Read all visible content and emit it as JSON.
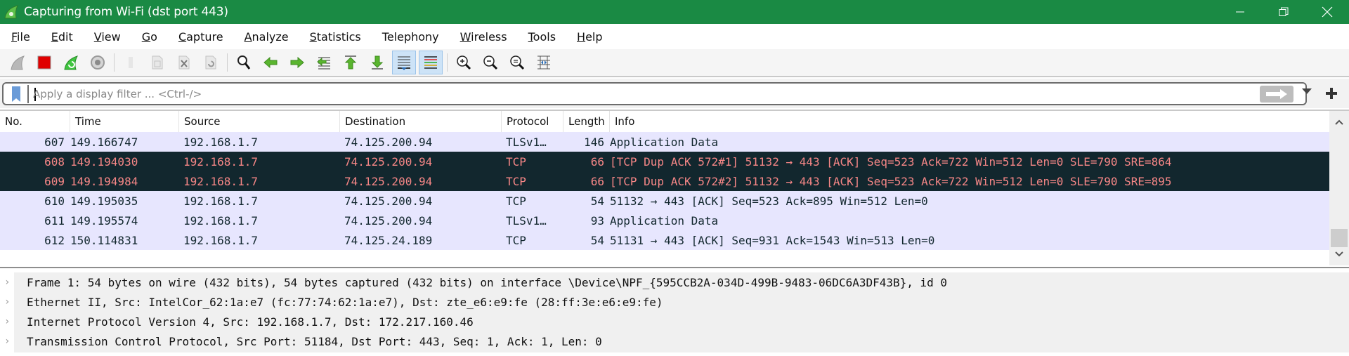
{
  "window": {
    "title": "Capturing from Wi-Fi (dst port 443)",
    "app_icon": "wireshark-capturing-icon",
    "controls": [
      "minimize-icon",
      "restore-icon",
      "close-icon"
    ]
  },
  "menu": [
    {
      "label": "File",
      "mnemonic": "F",
      "rest": "ile"
    },
    {
      "label": "Edit",
      "mnemonic": "E",
      "rest": "dit"
    },
    {
      "label": "View",
      "mnemonic": "V",
      "rest": "iew"
    },
    {
      "label": "Go",
      "mnemonic": "G",
      "rest": "o"
    },
    {
      "label": "Capture",
      "mnemonic": "C",
      "rest": "apture"
    },
    {
      "label": "Analyze",
      "mnemonic": "A",
      "rest": "nalyze"
    },
    {
      "label": "Statistics",
      "mnemonic": "S",
      "rest": "tatistics"
    },
    {
      "label": "Telephony",
      "mnemonic": "",
      "rest": "Telephony"
    },
    {
      "label": "Wireless",
      "mnemonic": "W",
      "rest": "ireless"
    },
    {
      "label": "Tools",
      "mnemonic": "T",
      "rest": "ools"
    },
    {
      "label": "Help",
      "mnemonic": "H",
      "rest": "elp"
    }
  ],
  "toolbar": {
    "buttons": [
      "start-capture-icon",
      "stop-capture-icon",
      "restart-capture-icon",
      "capture-options-icon",
      "open-file-icon",
      "save-file-icon",
      "close-file-icon",
      "reload-file-icon",
      "find-packet-icon",
      "go-back-icon",
      "go-forward-icon",
      "go-to-packet-icon",
      "go-first-packet-icon",
      "go-last-packet-icon",
      "autoscroll-icon",
      "colorize-icon",
      "zoom-in-icon",
      "zoom-out-icon",
      "normal-size-icon",
      "resize-columns-icon"
    ]
  },
  "filter": {
    "placeholder": "Apply a display filter ... <Ctrl-/>",
    "value": ""
  },
  "packet_list": {
    "columns": [
      "No.",
      "Time",
      "Source",
      "Destination",
      "Protocol",
      "Length",
      "Info"
    ],
    "rows": [
      {
        "no": "607",
        "time": "149.166747",
        "source": "192.168.1.7",
        "destination": "74.125.200.94",
        "protocol": "TLSv1…",
        "length": "146",
        "info": "Application Data",
        "style": "normal"
      },
      {
        "no": "608",
        "time": "149.194030",
        "source": "192.168.1.7",
        "destination": "74.125.200.94",
        "protocol": "TCP",
        "length": "66",
        "info": "[TCP Dup ACK 572#1] 51132 → 443 [ACK] Seq=523 Ack=722 Win=512 Len=0 SLE=790 SRE=864",
        "style": "dup"
      },
      {
        "no": "609",
        "time": "149.194984",
        "source": "192.168.1.7",
        "destination": "74.125.200.94",
        "protocol": "TCP",
        "length": "66",
        "info": "[TCP Dup ACK 572#2] 51132 → 443 [ACK] Seq=523 Ack=722 Win=512 Len=0 SLE=790 SRE=895",
        "style": "dup"
      },
      {
        "no": "610",
        "time": "149.195035",
        "source": "192.168.1.7",
        "destination": "74.125.200.94",
        "protocol": "TCP",
        "length": "54",
        "info": "51132 → 443 [ACK] Seq=523 Ack=895 Win=512 Len=0",
        "style": "normal"
      },
      {
        "no": "611",
        "time": "149.195574",
        "source": "192.168.1.7",
        "destination": "74.125.200.94",
        "protocol": "TLSv1…",
        "length": "93",
        "info": "Application Data",
        "style": "normal"
      },
      {
        "no": "612",
        "time": "150.114831",
        "source": "192.168.1.7",
        "destination": "74.125.24.189",
        "protocol": "TCP",
        "length": "54",
        "info": "51131 → 443 [ACK] Seq=931 Ack=1543 Win=513 Len=0",
        "style": "normal"
      }
    ],
    "colors": {
      "normal_bg": "#e7e6fe",
      "normal_fg": "#12272e",
      "dup_bg": "#12272e",
      "dup_fg": "#f78787"
    }
  },
  "packet_details": [
    {
      "expander": "›",
      "text": "Frame 1: 54 bytes on wire (432 bits), 54 bytes captured (432 bits) on interface \\Device\\NPF_{595CCB2A-034D-499B-9483-06DC6A3DF43B}, id 0"
    },
    {
      "expander": "›",
      "text": "Ethernet II, Src: IntelCor_62:1a:e7 (fc:77:74:62:1a:e7), Dst: zte_e6:e9:fe (28:ff:3e:e6:e9:fe)"
    },
    {
      "expander": "›",
      "text": "Internet Protocol Version 4, Src: 192.168.1.7, Dst: 172.217.160.46"
    },
    {
      "expander": "›",
      "text": "Transmission Control Protocol, Src Port: 51184, Dst Port: 443, Seq: 1, Ack: 1, Len: 0"
    }
  ],
  "theme": {
    "titlebar_bg": "#1a8a44"
  }
}
